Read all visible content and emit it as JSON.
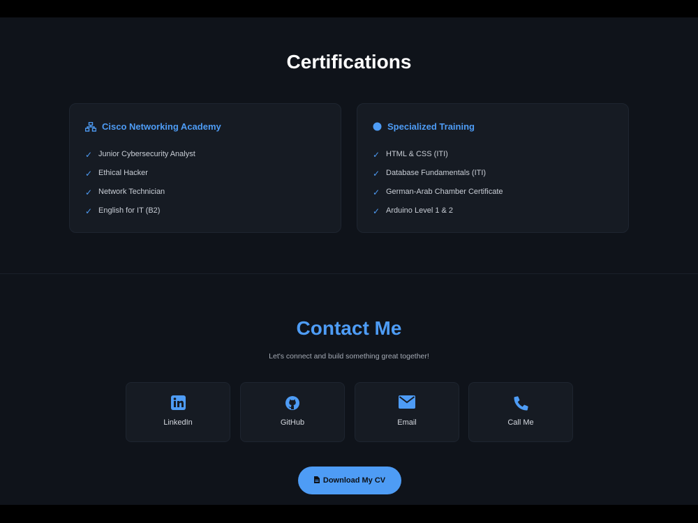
{
  "certifications": {
    "title": "Certifications",
    "cards": [
      {
        "heading": "Cisco Networking Academy",
        "icon": "network-icon",
        "items": [
          "Junior Cybersecurity Analyst",
          "Ethical Hacker",
          "Network Technician",
          "English for IT (B2)"
        ]
      },
      {
        "heading": "Specialized Training",
        "icon": "circle-icon",
        "items": [
          "HTML & CSS (ITI)",
          "Database Fundamentals (ITI)",
          "German-Arab Chamber Certificate",
          "Arduino Level 1 & 2"
        ]
      }
    ]
  },
  "contact": {
    "title": "Contact Me",
    "subtitle": "Let's connect and build something great together!",
    "links": [
      {
        "label": "LinkedIn",
        "icon": "linkedin-icon"
      },
      {
        "label": "GitHub",
        "icon": "github-icon"
      },
      {
        "label": "Email",
        "icon": "envelope-icon"
      },
      {
        "label": "Call Me",
        "icon": "phone-icon"
      }
    ],
    "cv_button": {
      "label": "Download My CV",
      "icon": "file-icon"
    }
  },
  "colors": {
    "accent": "#4e9cf5",
    "background": "#0f131a",
    "card": "#161b23"
  }
}
